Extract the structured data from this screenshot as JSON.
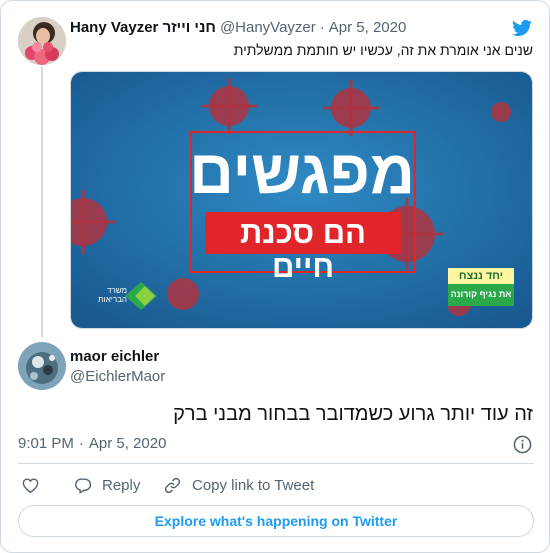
{
  "quoted_tweet": {
    "display_name": "Hany Vayzer חני וייזר",
    "handle": "@HanyVayzer",
    "separator": "·",
    "date": "Apr 5, 2020",
    "text": "שנים אני אומרת את זה, עכשיו יש חותמת ממשלתית",
    "media": {
      "headline": "מפגשים",
      "subline": "הם סכנת חיים",
      "ministry_logo_line1": "משרד",
      "ministry_logo_line2": "הבריאות",
      "badge_top": "יחד ננצח",
      "badge_bottom": "את נגיף קורונה"
    }
  },
  "reply_tweet": {
    "display_name": "maor eichler",
    "handle": "@EichlerMaor",
    "text": "זה עוד יותר גרוע כשמדובר בבחור מבני ברק",
    "time": "9:01 PM",
    "separator": "·",
    "date": "Apr 5, 2020"
  },
  "actions": {
    "reply_label": "Reply",
    "copy_link_label": "Copy link to Tweet"
  },
  "footer": {
    "explore_label": "Explore what's happening on Twitter"
  },
  "icons": {
    "brand": "twitter-bird-icon",
    "info": "info-icon",
    "like": "heart-icon",
    "reply": "speech-bubble-icon",
    "link": "link-icon"
  },
  "colors": {
    "twitter_blue": "#1d9bf0",
    "text_primary": "#0f1419",
    "text_secondary": "#536471",
    "border": "#cfd9de",
    "poster_blue": "#1f6ea8",
    "poster_red": "#e0262b",
    "badge_green": "#2aa84a"
  }
}
